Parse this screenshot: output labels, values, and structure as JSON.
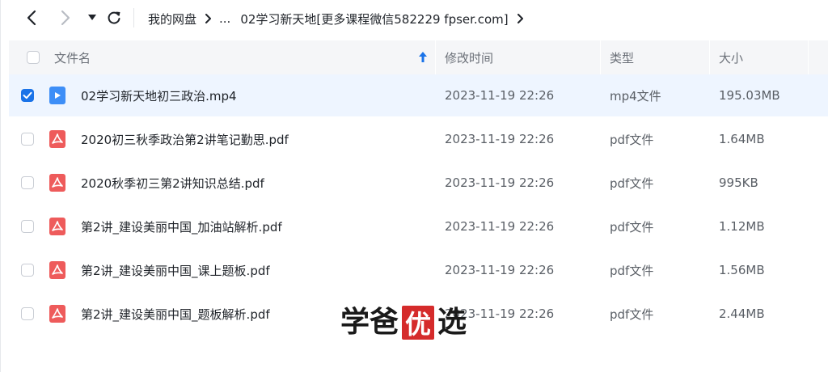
{
  "nav": {
    "back_icon": "chevron-left-icon",
    "forward_icon": "chevron-right-icon",
    "history_icon": "caret-down-icon",
    "refresh_icon": "refresh-icon"
  },
  "breadcrumb": {
    "root": "我的网盘",
    "ellipsis": "...",
    "current": "02学习新天地[更多课程微信582229 fpser.com]"
  },
  "table": {
    "columns": {
      "name": "文件名",
      "modified": "修改时间",
      "type": "类型",
      "size": "大小"
    },
    "sort_icon": "sort-up-arrow-icon",
    "rows": [
      {
        "name": "02学习新天地初三政治.mp4",
        "modified": "2023-11-19 22:26",
        "type": "mp4文件",
        "size": "195.03MB",
        "icon": "video-file-icon",
        "selected": true
      },
      {
        "name": "2020初三秋季政治第2讲笔记勤思.pdf",
        "modified": "2023-11-19 22:26",
        "type": "pdf文件",
        "size": "1.64MB",
        "icon": "pdf-file-icon",
        "selected": false
      },
      {
        "name": "2020秋季初三第2讲知识总结.pdf",
        "modified": "2023-11-19 22:26",
        "type": "pdf文件",
        "size": "995KB",
        "icon": "pdf-file-icon",
        "selected": false
      },
      {
        "name": "第2讲_建设美丽中国_加油站解析.pdf",
        "modified": "2023-11-19 22:26",
        "type": "pdf文件",
        "size": "1.12MB",
        "icon": "pdf-file-icon",
        "selected": false
      },
      {
        "name": "第2讲_建设美丽中国_课上题板.pdf",
        "modified": "2023-11-19 22:26",
        "type": "pdf文件",
        "size": "1.56MB",
        "icon": "pdf-file-icon",
        "selected": false
      },
      {
        "name": "第2讲_建设美丽中国_题板解析.pdf",
        "modified": "2023-11-19 22:26",
        "type": "pdf文件",
        "size": "2.44MB",
        "icon": "pdf-file-icon",
        "selected": false
      }
    ]
  },
  "watermark": {
    "chars": [
      "学",
      "爸",
      "优",
      "选"
    ]
  },
  "colors": {
    "accent": "#1a73e8",
    "selected_row": "#eef5ff",
    "header_bg": "#f5f6f8",
    "video_icon": "#3d8ef7",
    "pdf_icon": "#ee5b5b",
    "seal": "#d52b2b"
  }
}
